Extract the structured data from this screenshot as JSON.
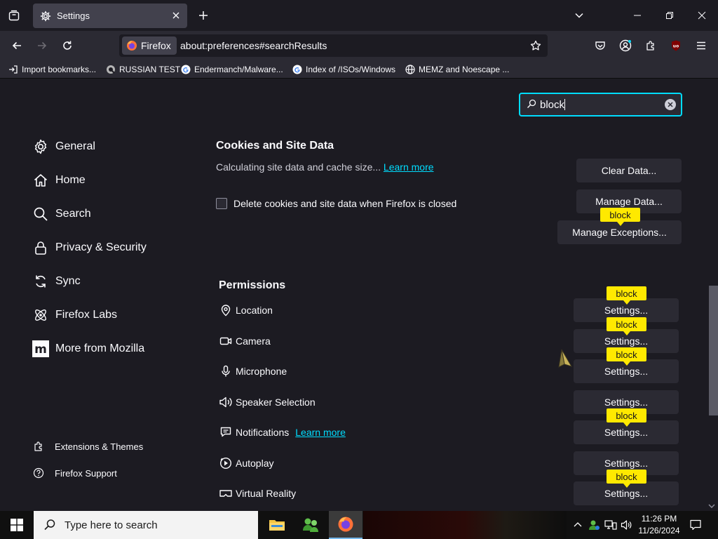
{
  "colors": {
    "accent": "#00ddff",
    "highlight": "#ffe900",
    "background": "#1c1b22",
    "toolbar": "#2b2a33"
  },
  "tabs": [
    {
      "title": "Settings",
      "icon": "gear-icon"
    }
  ],
  "navbar": {
    "identity_label": "Firefox",
    "url": "about:preferences#searchResults"
  },
  "bookmarks": [
    {
      "label": "Import bookmarks...",
      "icon": "import-icon"
    },
    {
      "label": "RUSSIAN TEST",
      "icon": "site-icon"
    },
    {
      "label": "Endermanch/Malware...",
      "icon": "google-icon"
    },
    {
      "label": "Index of /ISOs/Windows",
      "icon": "google-icon"
    },
    {
      "label": "MEMZ and Noescape ...",
      "icon": "globe-icon"
    }
  ],
  "search": {
    "value": "block"
  },
  "sidebar": {
    "items": [
      {
        "label": "General",
        "icon": "gear-icon"
      },
      {
        "label": "Home",
        "icon": "home-icon"
      },
      {
        "label": "Search",
        "icon": "search-icon"
      },
      {
        "label": "Privacy & Security",
        "icon": "lock-icon"
      },
      {
        "label": "Sync",
        "icon": "sync-icon"
      },
      {
        "label": "Firefox Labs",
        "icon": "labs-icon"
      },
      {
        "label": "More from Mozilla",
        "icon": "mozilla-icon"
      }
    ],
    "footer": [
      {
        "label": "Extensions & Themes",
        "icon": "puzzle-icon"
      },
      {
        "label": "Firefox Support",
        "icon": "help-icon"
      }
    ]
  },
  "cookies": {
    "title": "Cookies and Site Data",
    "description": "Calculating site data and cache size...",
    "learn_more": "Learn more",
    "checkbox_label": "Delete cookies and site data when Firefox is closed",
    "checkbox_checked": false,
    "buttons": {
      "clear_data": "Clear Data...",
      "manage_data": "Manage Data...",
      "manage_exceptions": "Manage Exceptions..."
    }
  },
  "permissions": {
    "title": "Permissions",
    "learn_more": "Learn more",
    "settings_label": "Settings...",
    "rows": [
      {
        "label": "Location",
        "icon": "location-icon"
      },
      {
        "label": "Camera",
        "icon": "camera-icon"
      },
      {
        "label": "Microphone",
        "icon": "microphone-icon"
      },
      {
        "label": "Speaker Selection",
        "icon": "speaker-icon"
      },
      {
        "label": "Notifications",
        "icon": "notification-icon"
      },
      {
        "label": "Autoplay",
        "icon": "autoplay-icon"
      },
      {
        "label": "Virtual Reality",
        "icon": "vr-icon"
      }
    ]
  },
  "highlight_badge": "block",
  "taskbar": {
    "search_placeholder": "Type here to search",
    "apps": [
      "file-explorer-icon",
      "network-app-icon",
      "firefox-icon"
    ],
    "clock_time": "11:26 PM",
    "clock_date": "11/26/2024"
  }
}
